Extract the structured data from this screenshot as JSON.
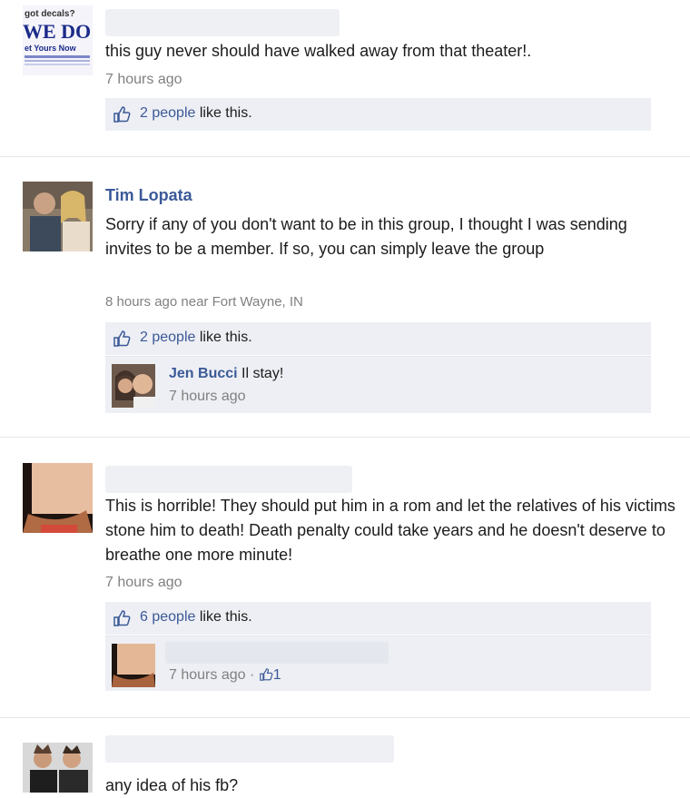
{
  "posts": [
    {
      "author": "",
      "avatar_lines": [
        "got decals?",
        "WE DO",
        "et Yours Now"
      ],
      "text": "this guy never should have walked away from that theater!.",
      "time": "7 hours ago",
      "likes": {
        "count_text": "2 people",
        "suffix": " like this."
      }
    },
    {
      "author": "Tim Lopata",
      "text": "Sorry if any of you don't want to be in this group, I thought I was sending invites to be a member. If so, you can simply leave the group",
      "time": "8 hours ago near Fort Wayne, IN",
      "likes": {
        "count_text": "2 people",
        "suffix": " like this."
      },
      "comment": {
        "author": "Jen Bucci",
        "text": " Il stay!",
        "time": "7 hours ago"
      }
    },
    {
      "author": "",
      "text": "This is horrible! They should put him in a rom and let the relatives of his victims stone him to death! Death penalty could take years and he doesn't deserve to breathe one more minute!",
      "time": "7 hours ago",
      "likes": {
        "count_text": "6 people",
        "suffix": " like this."
      },
      "comment": {
        "author": "",
        "time": "7 hours ago · ",
        "like_count": "1"
      }
    },
    {
      "author": "",
      "text": "any idea of his fb?"
    }
  ],
  "colors": {
    "link": "#3b5998",
    "bar": "#edeff4",
    "meta": "#808080"
  },
  "icons": {
    "like": "thumbs-up-icon"
  }
}
